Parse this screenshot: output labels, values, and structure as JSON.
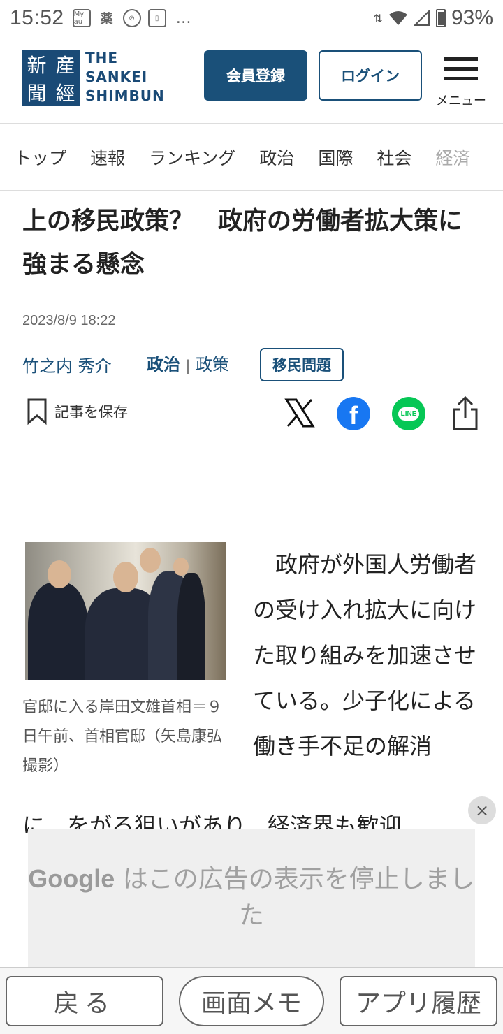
{
  "status_bar": {
    "time": "15:52",
    "icons": [
      "my-au-icon",
      "pharmacy-icon",
      "block-icon",
      "screenshot-icon"
    ],
    "my_au_label": "My au",
    "pharmacy_label": "薬",
    "overflow": "…",
    "battery": "93%"
  },
  "header": {
    "logo_kanji": [
      "産",
      "經",
      "新",
      "聞"
    ],
    "logo_line1": "THE",
    "logo_line2": "SANKEI",
    "logo_line3": "SHIMBUN",
    "register_label": "会員登録",
    "login_label": "ログイン",
    "menu_label": "メニュー"
  },
  "nav": {
    "items": [
      "トップ",
      "速報",
      "ランキング",
      "政治",
      "国際",
      "社会",
      "経済"
    ]
  },
  "article": {
    "title": "上の移民政策？　政府の労働者拡大策に強まる懸念",
    "date": "2023/8/9 18:22",
    "author": "竹之内 秀介",
    "category_main": "政治",
    "category_sep": "|",
    "category_sub": "政策",
    "tag": "移民問題",
    "save_label": "記事を保存",
    "caption": "官邸に入る岸田文雄首相＝９日午前、首相官邸（矢島康弘撮影）",
    "body": "　政府が外国人労働者の受け入れ拡大に向けた取り組みを加速させている。少子化による働き手不足の解消",
    "cut_line": "に…をがる狙いがあり、経済界も歓迎"
  },
  "ad": {
    "brand": "Google",
    "message": " はこの広告の表示を停止しました",
    "close": "×"
  },
  "bottom_bar": {
    "back": "戻る",
    "memo": "画面メモ",
    "history": "アプリ履歴"
  },
  "colors": {
    "brand_navy": "#1a4a76",
    "link_blue": "#1a5079",
    "facebook": "#1877f2",
    "line": "#06c755"
  }
}
